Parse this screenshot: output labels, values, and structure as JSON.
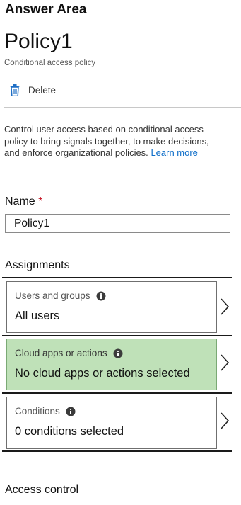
{
  "header": {
    "answer_area": "Answer Area"
  },
  "policy": {
    "title": "Policy1",
    "subtitle": "Conditional access policy"
  },
  "toolbar": {
    "delete_label": "Delete",
    "delete_icon": "trash-icon"
  },
  "description": {
    "text": "Control user access based on conditional access policy to bring signals together, to make decisions, and enforce organizational policies.",
    "link_text": "Learn more"
  },
  "name_field": {
    "label": "Name",
    "required_marker": "*",
    "value": "Policy1"
  },
  "assignments": {
    "heading": "Assignments",
    "users": {
      "label": "Users and groups",
      "value": "All users",
      "icon": "info-icon"
    },
    "cloud_apps": {
      "label": "Cloud apps or actions",
      "value": "No cloud apps or actions selected",
      "icon": "info-icon",
      "selected": true
    },
    "conditions": {
      "label": "Conditions",
      "value": "0 conditions selected",
      "icon": "info-icon"
    }
  },
  "access_control": {
    "heading": "Access control"
  },
  "colors": {
    "link": "#0b6cc8",
    "required": "#c50f1f",
    "selected_tile": "#bfe1b8",
    "delete_icon": "#1f6fc5"
  }
}
